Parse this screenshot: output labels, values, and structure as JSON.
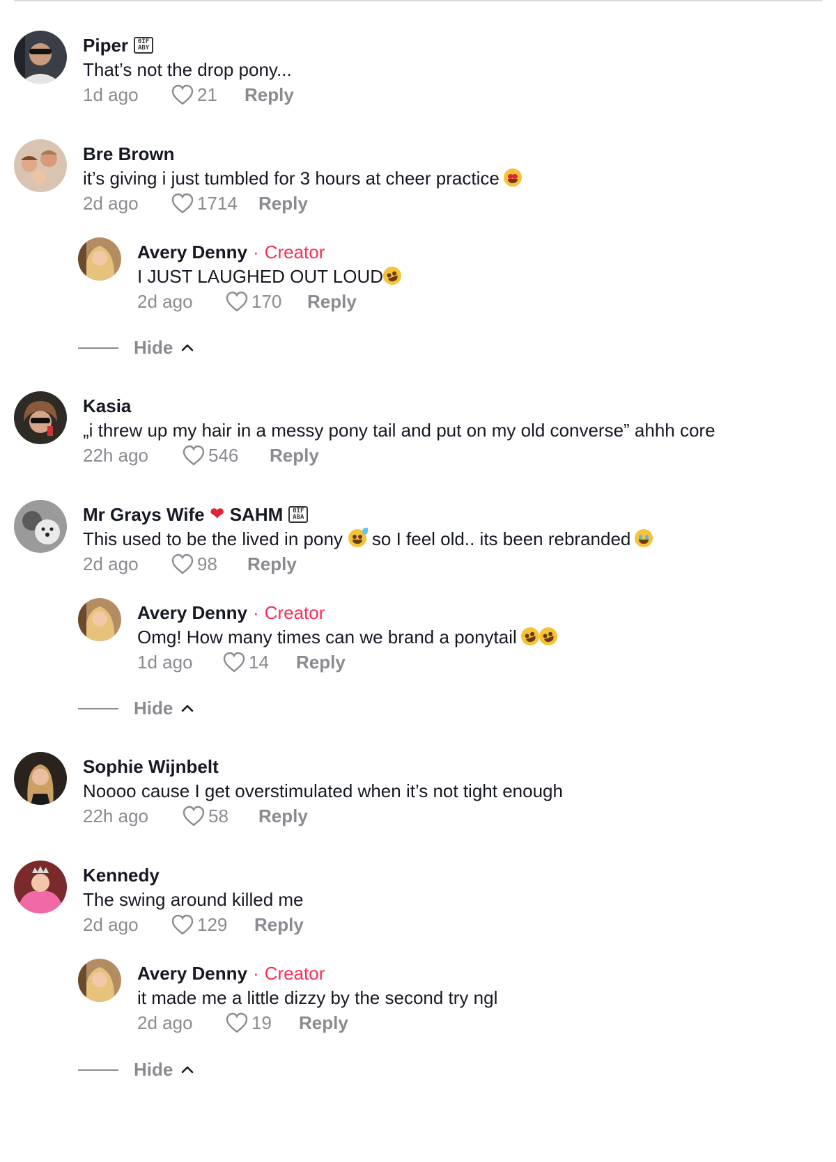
{
  "colors": {
    "creator": "#fe2c55",
    "meta": "#8a8b91",
    "text": "#161823"
  },
  "comments": [
    {
      "name": "Piper",
      "text": "That’s not the drop pony...",
      "time": "1d ago",
      "likes": "21",
      "reply": "Reply",
      "badge": "0IF ABY"
    },
    {
      "name": "Bre Brown",
      "text": "it’s giving i just tumbled for 3 hours at cheer practice",
      "time": "2d ago",
      "likes": "1714",
      "reply": "Reply"
    },
    {
      "name": "Avery Denny",
      "creator": "Creator",
      "text": "I JUST LAUGHED OUT LOUD",
      "time": "2d ago",
      "likes": "170",
      "reply": "Reply"
    },
    {
      "name": "Kasia",
      "text": "„i threw up my hair in a messy pony tail and put on my old converse” ahhh core",
      "time": "22h ago",
      "likes": "546",
      "reply": "Reply"
    },
    {
      "name": "Mr Grays Wife",
      "name2": "SAHM",
      "badge": "0IF ABA",
      "text": "This used to be the lived in pony",
      "text2": "so I feel old.. its been rebranded",
      "time": "2d ago",
      "likes": "98",
      "reply": "Reply"
    },
    {
      "name": "Avery Denny",
      "creator": "Creator",
      "text": "Omg! How many times can we brand a ponytail",
      "time": "1d ago",
      "likes": "14",
      "reply": "Reply"
    },
    {
      "name": "Sophie Wijnbelt",
      "text": "Noooo cause I get overstimulated when it’s not tight enough",
      "time": "22h ago",
      "likes": "58",
      "reply": "Reply"
    },
    {
      "name": "Kennedy",
      "text": "The swing around killed me",
      "time": "2d ago",
      "likes": "129",
      "reply": "Reply"
    },
    {
      "name": "Avery Denny",
      "creator": "Creator",
      "text": "it made me a little dizzy by the second try ngl",
      "time": "2d ago",
      "likes": "19",
      "reply": "Reply"
    }
  ],
  "hide_label": "Hide",
  "separator": "·"
}
